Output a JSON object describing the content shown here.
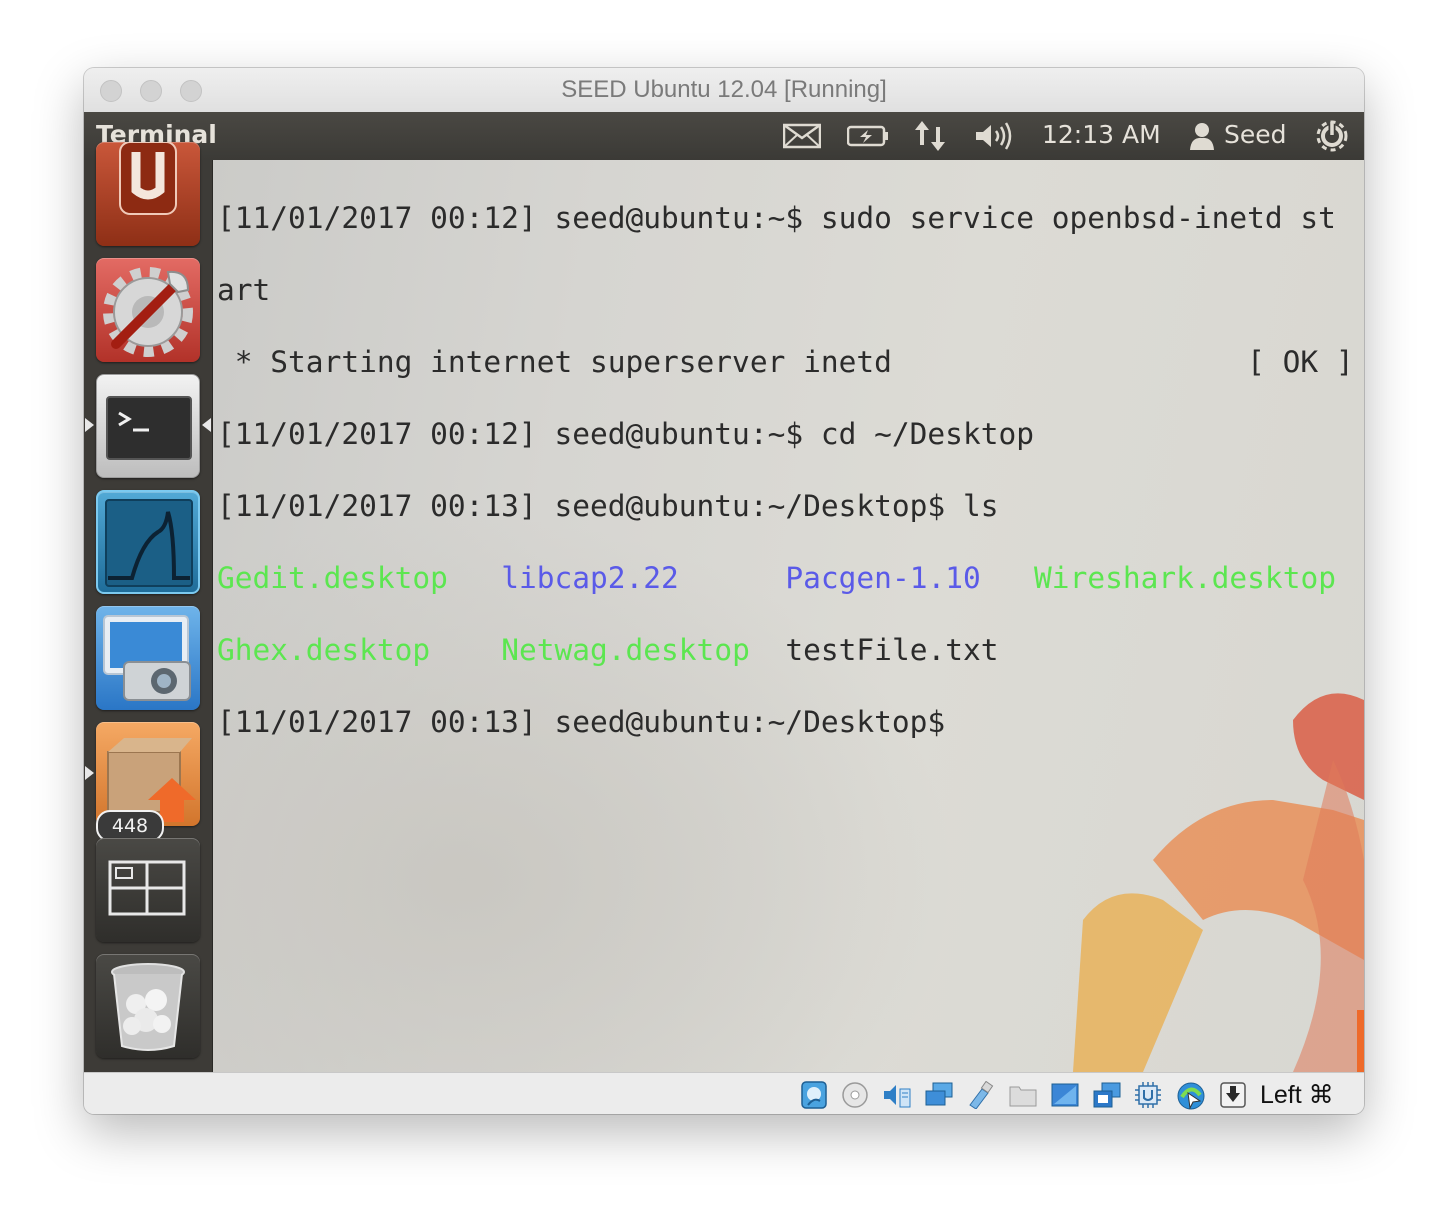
{
  "window": {
    "title": "SEED Ubuntu 12.04 [Running]"
  },
  "panel": {
    "app_title": "Terminal",
    "clock": "12:13 AM",
    "user": "Seed",
    "indicators": [
      "mail-icon",
      "battery-icon",
      "network-icon",
      "volume-icon",
      "user-icon",
      "power-icon"
    ]
  },
  "launcher": {
    "items": [
      {
        "name": "ubuntu-one-icon"
      },
      {
        "name": "system-settings-icon"
      },
      {
        "name": "terminal-icon"
      },
      {
        "name": "wireshark-icon"
      },
      {
        "name": "screenshot-icon"
      },
      {
        "name": "update-manager-icon",
        "badge": "448"
      },
      {
        "name": "workspace-switcher-icon"
      },
      {
        "name": "trash-icon"
      }
    ]
  },
  "terminal": {
    "line1": "[11/01/2017 00:12] seed@ubuntu:~$ sudo service openbsd-inetd st",
    "line2": "art",
    "line3": " * Starting internet superserver inetd                    [ OK ]",
    "line4": "[11/01/2017 00:12] seed@ubuntu:~$ cd ~/Desktop",
    "line5": "[11/01/2017 00:13] seed@ubuntu:~/Desktop$ ls",
    "ls_row1": [
      "Gedit.desktop",
      "libcap2.22",
      "Pacgen-1.10",
      "Wireshark.desktop"
    ],
    "ls_row2": [
      "Ghex.desktop",
      "Netwag.desktop",
      "testFile.txt"
    ],
    "line8": "[11/01/2017 00:13] seed@ubuntu:~/Desktop$",
    "colors": {
      "executable": "#5ce650",
      "directory": "#5a5ae8",
      "regular": "#2b2b2b"
    }
  },
  "statusbar": {
    "icons": [
      "hard-disk-icon",
      "optical-drive-icon",
      "audio-icon",
      "network-adapter-icon",
      "usb-icon",
      "shared-folders-icon",
      "display-icon",
      "video-capture-icon",
      "cpu-icon",
      "mouse-integration-icon",
      "keyboard-capture-icon"
    ],
    "host_key": "Left ⌘"
  }
}
